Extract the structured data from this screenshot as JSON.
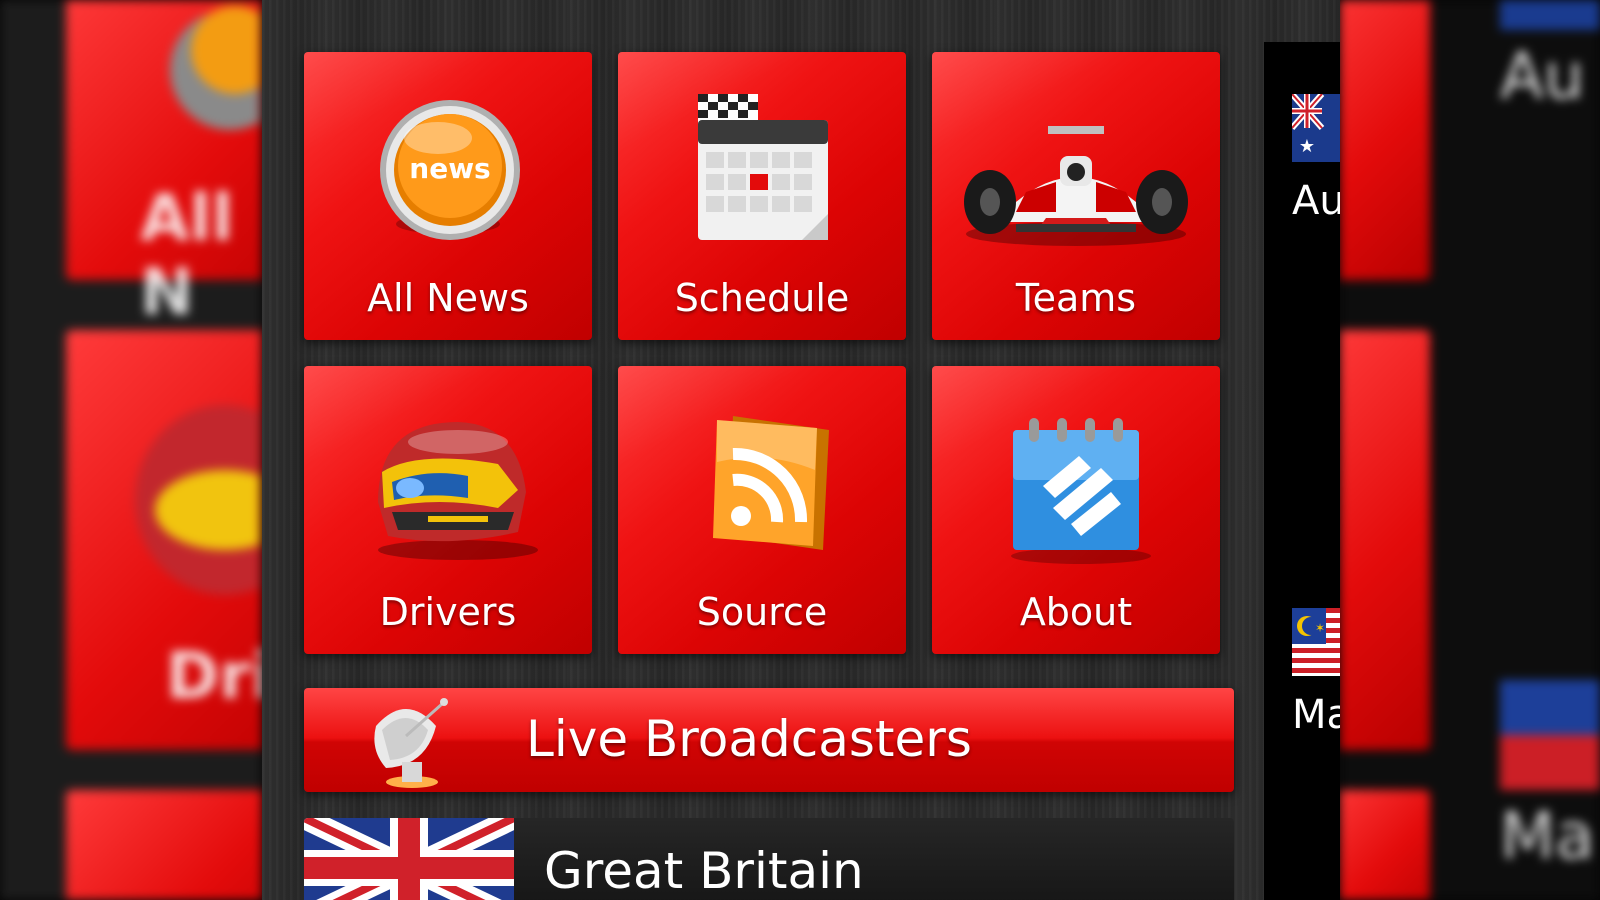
{
  "menu": {
    "tiles": [
      {
        "label": "All News",
        "icon": "news-icon"
      },
      {
        "label": "Schedule",
        "icon": "calendar-icon"
      },
      {
        "label": "Teams",
        "icon": "race-car-icon"
      },
      {
        "label": "Drivers",
        "icon": "helmet-icon"
      },
      {
        "label": "Source",
        "icon": "rss-icon"
      },
      {
        "label": "About",
        "icon": "notepad-icon"
      }
    ],
    "news_badge": "news"
  },
  "live": {
    "label": "Live Broadcasters",
    "icon": "satellite-dish-icon"
  },
  "broadcasters": [
    {
      "country": "Great Britain",
      "flag": "uk-flag-icon"
    }
  ],
  "side_list": [
    {
      "name": "Au",
      "flag": "australia-flag-icon"
    },
    {
      "name": "Ma",
      "flag": "malaysia-flag-icon"
    }
  ],
  "backdrop": {
    "left_texts": [
      "All N",
      "Dri"
    ],
    "right_texts": [
      "Au",
      "Ma"
    ]
  },
  "colors": {
    "accent_red": "#e30b0b",
    "panel_black": "#000000"
  }
}
